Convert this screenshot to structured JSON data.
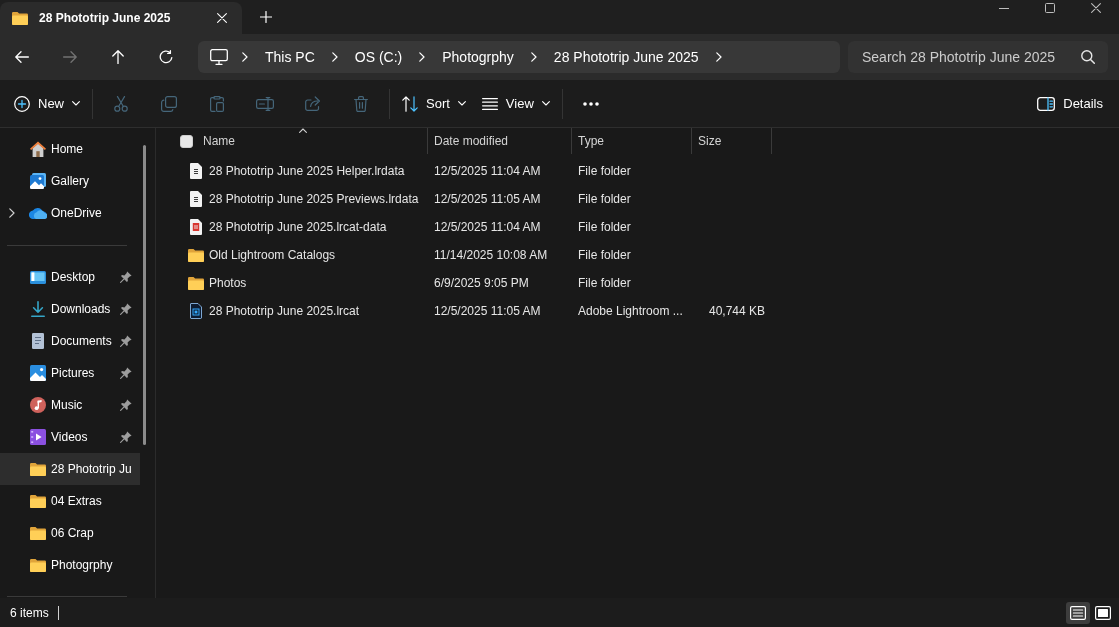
{
  "tabs": [
    {
      "title": "28 Phototrip June 2025",
      "selected": true
    }
  ],
  "navigation": [
    {
      "kind": "back",
      "disabled": false
    },
    {
      "kind": "forward",
      "disabled": true
    },
    {
      "kind": "up",
      "disabled": false
    },
    {
      "kind": "refresh",
      "disabled": false
    }
  ],
  "address_bar": {
    "segments": [
      "This PC",
      "OS (C:)",
      "Photogrphy",
      "28 Phototrip June 2025"
    ]
  },
  "search": {
    "placeholder": "Search 28 Phototrip June 2025"
  },
  "command_bar": {
    "groups": [
      [
        {
          "kind": "new",
          "label": "New",
          "disabled": false
        }
      ],
      [
        {
          "kind": "cut",
          "disabled": true
        },
        {
          "kind": "copy",
          "disabled": true
        },
        {
          "kind": "paste",
          "disabled": true
        },
        {
          "kind": "rename",
          "disabled": true
        },
        {
          "kind": "share",
          "disabled": true
        },
        {
          "kind": "delete",
          "disabled": true
        }
      ],
      [
        {
          "kind": "sort",
          "label": "Sort",
          "disabled": false
        },
        {
          "kind": "view",
          "label": "View",
          "disabled": false
        }
      ],
      [
        {
          "kind": "more",
          "disabled": false
        }
      ]
    ],
    "details": {
      "label": "Details"
    }
  },
  "sidebar": {
    "sections": [
      {
        "items": [
          {
            "label": "Home",
            "kind": "home",
            "expandable": false,
            "pinned": false,
            "selected": false
          },
          {
            "label": "Gallery",
            "kind": "gallery",
            "expandable": false,
            "pinned": false,
            "selected": false
          },
          {
            "label": "OneDrive",
            "kind": "onedrive",
            "expandable": true,
            "pinned": false,
            "selected": false
          }
        ]
      },
      {
        "items": [
          {
            "label": "Desktop",
            "kind": "desktop",
            "expandable": false,
            "pinned": true,
            "selected": false
          },
          {
            "label": "Downloads",
            "kind": "downloads",
            "expandable": false,
            "pinned": true,
            "selected": false
          },
          {
            "label": "Documents",
            "kind": "documents",
            "expandable": false,
            "pinned": true,
            "selected": false
          },
          {
            "label": "Pictures",
            "kind": "pictures",
            "expandable": false,
            "pinned": true,
            "selected": false
          },
          {
            "label": "Music",
            "kind": "music",
            "expandable": false,
            "pinned": true,
            "selected": false
          },
          {
            "label": "Videos",
            "kind": "videos",
            "expandable": false,
            "pinned": true,
            "selected": false
          },
          {
            "label": "28 Phototrip Ju",
            "kind": "folder",
            "expandable": false,
            "pinned": false,
            "selected": true
          },
          {
            "label": "04 Extras",
            "kind": "folder",
            "expandable": false,
            "pinned": false,
            "selected": false
          },
          {
            "label": "06 Crap",
            "kind": "folder",
            "expandable": false,
            "pinned": false,
            "selected": false
          },
          {
            "label": "Photogrphy",
            "kind": "folder",
            "expandable": false,
            "pinned": false,
            "selected": false
          }
        ]
      }
    ]
  },
  "file_list": {
    "select_all": {
      "checked": false
    },
    "columns": [
      {
        "label": "Name",
        "sorted": true
      },
      {
        "label": "Date modified",
        "sorted": false
      },
      {
        "label": "Type",
        "sorted": false
      },
      {
        "label": "Size",
        "sorted": false
      }
    ],
    "rows": [
      {
        "name": "28 Phototrip June 2025 Helper.lrdata",
        "kind": "document",
        "date_modified": "12/5/2025 11:04 AM",
        "type": "File folder"
      },
      {
        "name": "28 Phototrip June 2025 Previews.lrdata",
        "kind": "document",
        "date_modified": "12/5/2025 11:05 AM",
        "type": "File folder"
      },
      {
        "name": "28 Phototrip June 2025.lrcat-data",
        "kind": "data",
        "date_modified": "12/5/2025 11:04 AM",
        "type": "File folder"
      },
      {
        "name": "Old Lightroom Catalogs",
        "kind": "folder",
        "date_modified": "11/14/2025 10:08 AM",
        "type": "File folder"
      },
      {
        "name": "Photos",
        "kind": "folder",
        "date_modified": "6/9/2025 9:05 PM",
        "type": "File folder"
      },
      {
        "name": "28 Phototrip June 2025.lrcat",
        "kind": "catalog",
        "date_modified": "12/5/2025 11:05 AM",
        "type": "Adobe Lightroom ...",
        "size": "40,744 KB"
      }
    ]
  },
  "status_bar": {
    "item_count": "6 items",
    "views": [
      {
        "kind": "details",
        "selected": true
      },
      {
        "kind": "tiles",
        "selected": false
      }
    ]
  }
}
